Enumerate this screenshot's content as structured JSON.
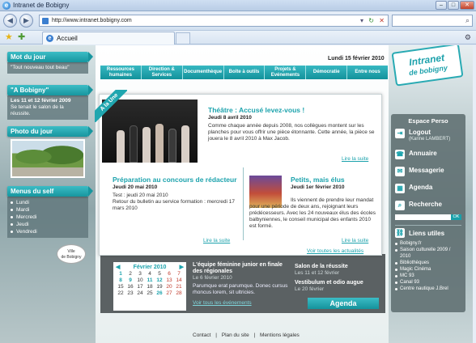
{
  "window": {
    "title": "Intranet de Bobigny"
  },
  "browser": {
    "url": "http://www.intranet.bobigny.com",
    "tab_label": "Accueil"
  },
  "header": {
    "date": "Lundi 15 février 2010",
    "logo_line1": "Intranet",
    "logo_line2": "de bobigny",
    "nav": [
      "Ressources humaines",
      "Direction & Services",
      "Documenthèque",
      "Boîte à outils",
      "Projets & Evénements",
      "Démocratie",
      "Entre nous"
    ]
  },
  "left": {
    "mot_title": "Mot du jour",
    "mot_text": "\"Tout nouveau tout beau\"",
    "bobigny_title": "\"A Bobigny\"",
    "bobigny_date": "Les 11 et 12 février 2009",
    "bobigny_text": "Se tenait le salon de la réussite.",
    "photo_title": "Photo du jour",
    "menus_title": "Menus du self",
    "menus": [
      "Lundi",
      "Mardi",
      "Mercredi",
      "Jeudi",
      "Vendredi"
    ],
    "logo_line1": "Ville",
    "logo_line2": "de Bobigny"
  },
  "main": {
    "ribbon": "A la Une",
    "featured": {
      "title": "Théâtre : Accusé levez-vous !",
      "date": "Jeudi 8 avril 2010",
      "text": "Comme chaque année depuis 2008, nos collègues montent sur les planches pour vous offrir une pièce étonnante. Cette année, la pièce se jouera le 8 avril 2010 à Max Jacob.",
      "more": "Lire la suite"
    },
    "article2": {
      "title": "Préparation au concours de rédacteur",
      "date": "Jeudi 20 mai 2010",
      "text": "Test : jeudi 20 mai 2010\nRetour du bulletin au service formation : mercredi 17 mars 2010",
      "more": "Lire la suite"
    },
    "article3": {
      "title": "Petits, mais élus",
      "date": "Jeudi 1er février 2010",
      "text": "Ils viennent de prendre leur mandat pour une période de deux ans, rejoignant leurs prédécesseurs. Avec les 24 nouveaux élus des écoles balbyniennes, le conseil municipal des enfants 2010 est formé.",
      "more": "Lire la suite"
    },
    "all_news": "Voir toutes les actualités"
  },
  "calendar": {
    "month": "Février 2010",
    "prev": "◀",
    "next": "▶",
    "weeks": [
      [
        "1",
        "2",
        "3",
        "4",
        "5",
        "6",
        "7"
      ],
      [
        "8",
        "9",
        "10",
        "11",
        "12",
        "13",
        "14"
      ],
      [
        "15",
        "16",
        "17",
        "18",
        "19",
        "20",
        "21"
      ],
      [
        "22",
        "23",
        "24",
        "25",
        "26",
        "27",
        "28"
      ]
    ]
  },
  "events": {
    "e1_title": "L'équipe féminine junior en finale des régionales",
    "e1_date": "Le 6 février 2010",
    "e1_text": "Parumque erat parumque. Donec cursus rhoncus lorem, sit ultricies.",
    "e1_link": "Voir tous les événements",
    "e2_title": "Salon de la réussite",
    "e2_date": "Les 11 et 12 février",
    "e3_title": "Vestibulum et odio augue",
    "e3_date": "Le 20 février",
    "agenda": "Agenda"
  },
  "right": {
    "title": "Espace Perso",
    "logout": "Logout",
    "logout_user": "(Karine LAMBERT)",
    "annuaire": "Annuaire",
    "messagerie": "Messagerie",
    "agenda": "Agenda",
    "recherche": "Recherche",
    "ok": "OK",
    "liens_title": "Liens utiles",
    "liens": [
      "Bobigny.fr",
      "Saison culturelle 2009 / 2010",
      "Bibliothèques",
      "Magic Cinéma",
      "MC 93",
      "Canal 93",
      "Centre nautique J.Brel"
    ]
  },
  "footer": {
    "contact": "Contact",
    "sep": "|",
    "plan": "Plan du site",
    "mentions": "Mentions légales"
  }
}
